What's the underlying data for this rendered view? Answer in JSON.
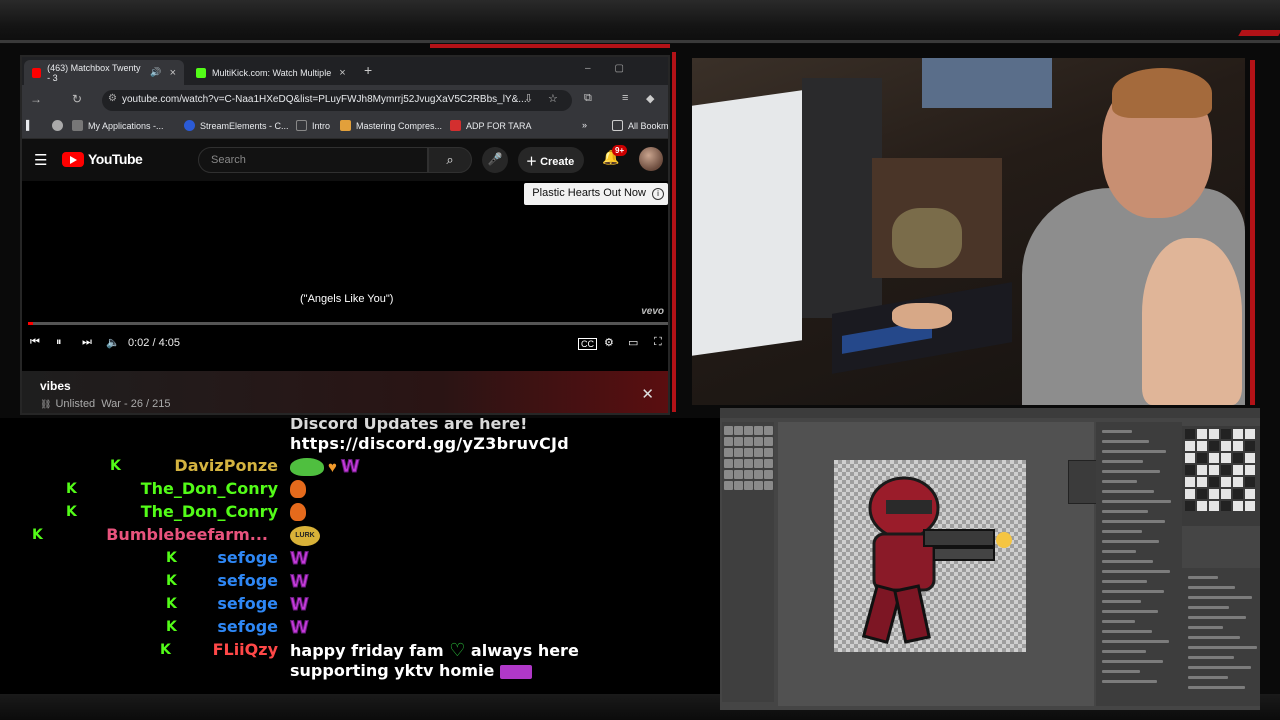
{
  "browser": {
    "tabs": [
      {
        "label": "(463) Matchbox Twenty - 3"
      },
      {
        "label": "MultiKick.com: Watch Multiple"
      }
    ],
    "url": "youtube.com/watch?v=C-Naa1HXeDQ&list=PLuyFWJh8Mymrrj52JvugXaV5C2RBbs_lY&...",
    "bookmarks": [
      {
        "label": "My Applications -..."
      },
      {
        "label": "StreamElements - C..."
      },
      {
        "label": "Intro"
      },
      {
        "label": "Mastering Compres..."
      },
      {
        "label": "ADP FOR TARA"
      },
      {
        "label": "All Bookm"
      }
    ]
  },
  "youtube": {
    "logo": "YouTube",
    "search_placeholder": "Search",
    "create_label": "Create",
    "notif_badge": "9+",
    "promo": "Plastic Hearts Out Now",
    "caption": "(\"Angels Like You\")",
    "watermark": "vevo",
    "time": "0:02 / 4:05",
    "progress": 0.008,
    "playlist_title": "vibes",
    "playlist_visibility": "Unlisted",
    "playlist_meta": "War - 26 / 215"
  },
  "chat": {
    "top_cut": "Discord Updates are here!",
    "link": "https://discord.gg/yZ3bruvCJd",
    "messages": [
      {
        "user": "DavizPonze",
        "color": "#d4b340",
        "emotes": [
          "pepe",
          "heart",
          "w"
        ]
      },
      {
        "user": "The_Don_Conry",
        "color": "#53fc18",
        "emotes": [
          "orange"
        ]
      },
      {
        "user": "The_Don_Conry",
        "color": "#53fc18",
        "emotes": [
          "orange"
        ]
      },
      {
        "user": "Bumblebeefarm...",
        "color": "#e8537d",
        "emotes": [
          "lurk"
        ]
      },
      {
        "user": "sefoge",
        "color": "#2e87f5",
        "emotes": [
          "w"
        ]
      },
      {
        "user": "sefoge",
        "color": "#2e87f5",
        "emotes": [
          "w"
        ]
      },
      {
        "user": "sefoge",
        "color": "#2e87f5",
        "emotes": [
          "w"
        ]
      },
      {
        "user": "sefoge",
        "color": "#2e87f5",
        "emotes": [
          "w"
        ]
      },
      {
        "user": "FLiiQzy",
        "color": "#ff4848",
        "text_a": "happy friday fam",
        "text_b": "always here",
        "text_c": "supporting yktv homie"
      }
    ],
    "lurk_label": "LURK"
  },
  "colors": {
    "accent_red": "#b31217",
    "kick_green": "#53fc18"
  }
}
